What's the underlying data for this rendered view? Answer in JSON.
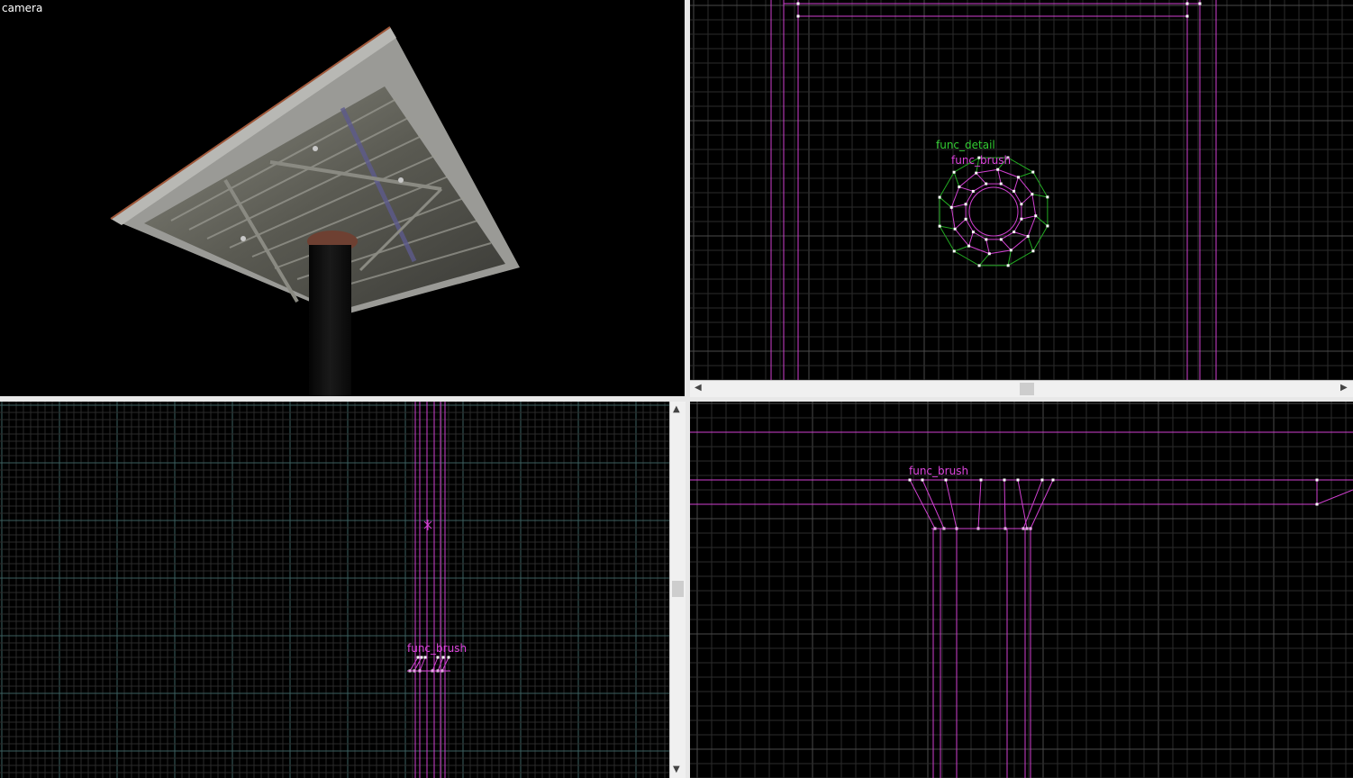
{
  "viewports": {
    "camera": {
      "label": "camera"
    },
    "top": {
      "labels": {
        "func_detail": "func_detail",
        "func_brush": "func_brush"
      }
    },
    "side": {
      "labels": {
        "func_brush": "func_brush"
      }
    },
    "front": {
      "labels": {
        "func_brush": "func_brush"
      }
    }
  },
  "colors": {
    "background": "#000000",
    "grid_minor": "#2e2e2e",
    "grid_major": "#3f6464",
    "brush": "#d040d0",
    "detail": "#22aa22",
    "vertex": "#ffffff"
  },
  "icons": {
    "scroll_left": "◀",
    "scroll_right": "▶",
    "scroll_up": "▲",
    "scroll_down": "▼"
  }
}
